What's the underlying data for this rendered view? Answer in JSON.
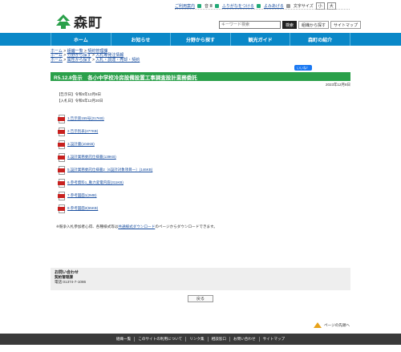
{
  "site": {
    "logo_text": "森町"
  },
  "util": {
    "links": [
      "ご利用案内",
      "音 Ⅲ",
      "ふりがなをつける",
      "よみあげる"
    ],
    "font_label": "文字サイズ",
    "btn_small": "小",
    "btn_large": "大"
  },
  "header": {
    "search_placeholder": "キーワード検索",
    "search_button": "検索",
    "org_search_button": "組織から探す",
    "sitemap_button": "サイトマップ"
  },
  "nav": {
    "items": [
      "ホーム",
      "お知らせ",
      "分野から探す",
      "観光ガイド",
      "森町の紹介"
    ]
  },
  "breadcrumbs": {
    "line1": [
      "ホーム",
      "組織一覧",
      "契約管理課"
    ],
    "line2": [
      "ホーム",
      "分野から探す",
      "入札等発注情報"
    ],
    "line3": [
      "ホーム",
      "属性から探す",
      "入札・調達・売却・契約"
    ]
  },
  "like_label": "いいね！",
  "page": {
    "title": "R5.12.8告示　各小中学校冷房設備設置工事調査設計業務委託",
    "date": "2023年12月8日",
    "notice_date": "【告示日】令和5年12月8日",
    "bid_date": "【入札日】令和5年12月20日"
  },
  "files": [
    "1.告示第155号(217KB)",
    "2.告示別表(277KB)",
    "3.設計書(104KB)",
    "4.設計業務委託仕様書(139KB)",
    "5.設計業務委託仕様書2（6設計対象項目一）(146KB)",
    "6.参考資料1_動力変電内容(311KB)",
    "7.参考図面1(2MB)",
    "8.参考図面2(65KB)"
  ],
  "note": {
    "before": "※競争入札参加者心得、各種様式等は",
    "link": "共通様式ダウンロード",
    "after": "のページからダウンロードできます。"
  },
  "contact": {
    "heading": "お問い合わせ",
    "dept": "契約管理課",
    "tel": "電話:01374-7-1086"
  },
  "back_button": "戻る",
  "pagetop_label": "ページの先頭へ",
  "footer": {
    "links": [
      "組織一覧",
      "このサイトの利用について",
      "リンク集",
      "相談窓口",
      "お問い合わせ",
      "サイトマップ"
    ]
  },
  "colors": {
    "nav": "#0a88c8",
    "title_bar": "#2aa04a",
    "footer": "#3a3a3a",
    "pdf": "#c8201e"
  }
}
